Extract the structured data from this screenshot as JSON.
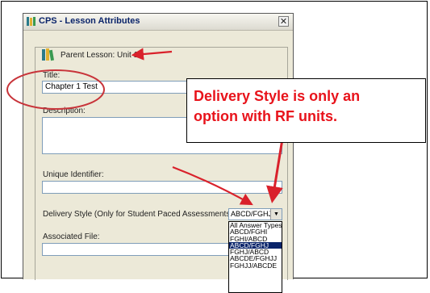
{
  "window": {
    "title": "CPS - Lesson Attributes",
    "close_glyph": "✕"
  },
  "parent_lesson": {
    "label": "Parent Lesson: Unit 1"
  },
  "fields": {
    "title_label": "Title:",
    "title_value": "Chapter 1 Test",
    "description_label": "Description:",
    "unique_id_label": "Unique Identifier:",
    "delivery_label": "Delivery Style (Only for Student Paced Assessments):",
    "associated_file_label": "Associated File:"
  },
  "delivery_select": {
    "selected": "ABCD/FGHJ",
    "options": [
      "All Answer Types",
      "ABCD/FGHI",
      "FGHI/ABCD",
      "ABCD/FGHJ",
      "FGHJ/ABCD",
      "ABCDE/FGHJJ",
      "FGHJJ/ABCDE"
    ],
    "highlighted_index": 3
  },
  "annotation": {
    "line1": "Delivery Style is only an",
    "line2": "option with RF units.",
    "color": "#e8131b"
  },
  "icons": {
    "app": "books-icon",
    "parent_lesson": "books-icon",
    "close": "close-icon",
    "dropdown": "chevron-down-icon"
  }
}
